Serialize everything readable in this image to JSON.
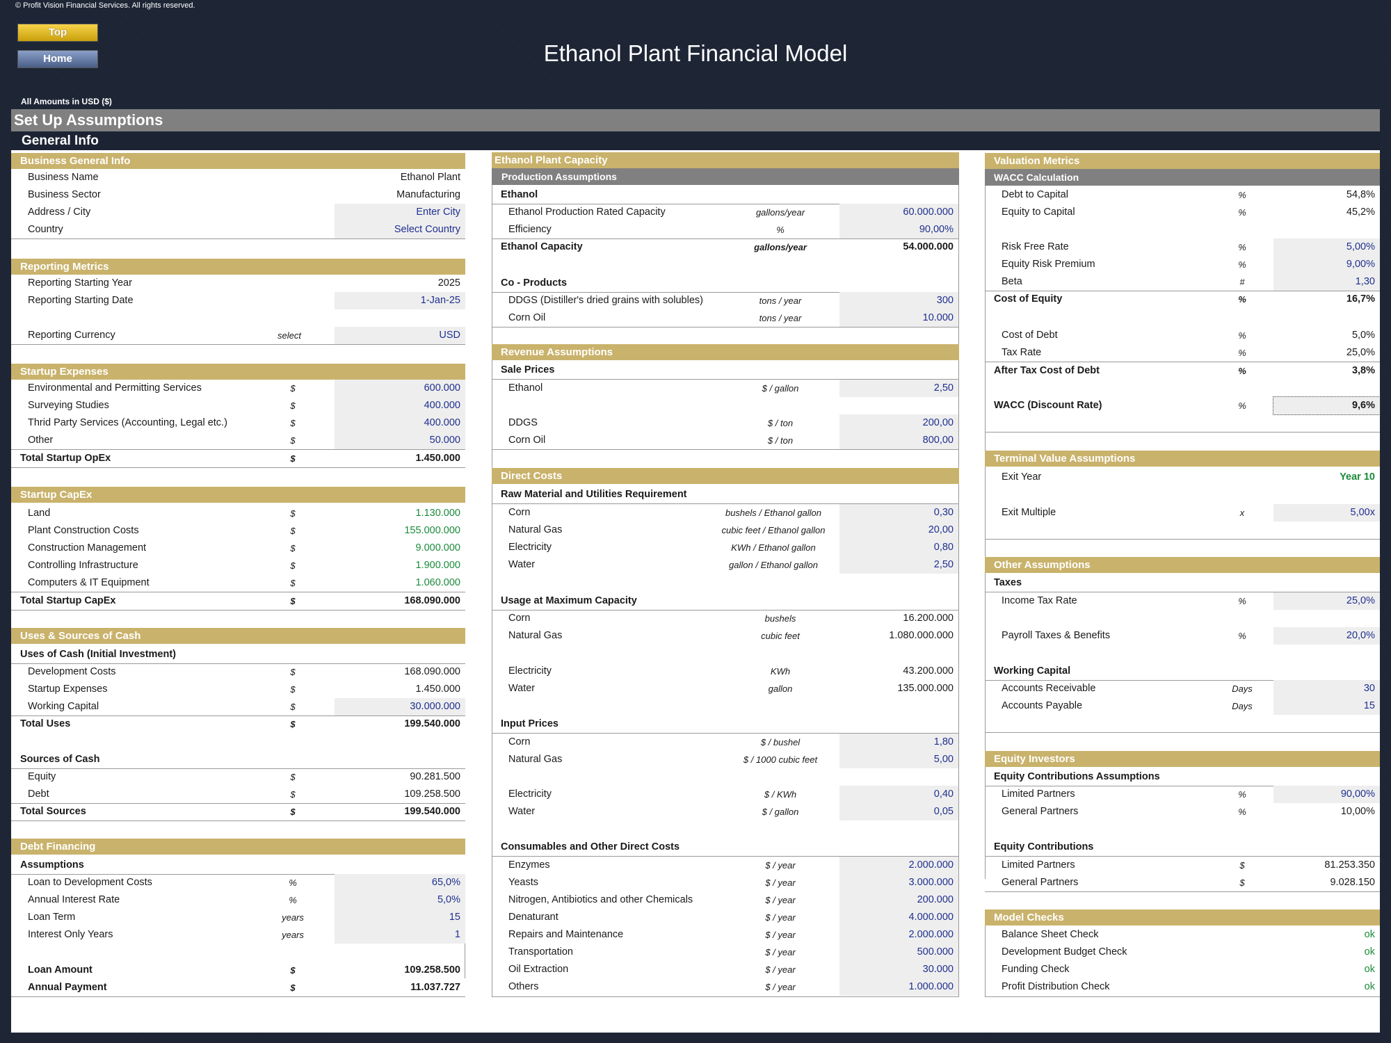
{
  "copyright": "© Profit Vision Financial Services. All rights reserved.",
  "nav": {
    "top": "Top",
    "home": "Home"
  },
  "title": "Ethanol Plant Financial Model",
  "amounts": "All Amounts in  USD ($)",
  "setup": "Set Up Assumptions",
  "general_info": "General Info",
  "col1": {
    "bgi": {
      "title": "Business General Info",
      "name_l": "Business Name",
      "name_v": "Ethanol Plant",
      "sector_l": "Business Sector",
      "sector_v": "Manufacturing",
      "addr_l": "Address / City",
      "addr_v": "Enter City",
      "country_l": "Country",
      "country_v": "Select Country"
    },
    "rep": {
      "title": "Reporting Metrics",
      "year_l": "Reporting Starting Year",
      "year_v": "2025",
      "date_l": "Reporting Starting Date",
      "date_v": "1-Jan-25",
      "cur_l": "Reporting Currency",
      "cur_u": "select",
      "cur_v": "USD"
    },
    "sx": {
      "title": "Startup Expenses",
      "r1": "Environmental and Permitting Services",
      "v1": "600.000",
      "r2": "Surveying Studies",
      "v2": "400.000",
      "r3": "Thrid Party Services (Accounting, Legal etc.)",
      "v3": "400.000",
      "r4": "Other",
      "v4": "50.000",
      "tot": "Total Startup OpEx",
      "totv": "1.450.000",
      "u": "$"
    },
    "sc": {
      "title": "Startup CapEx",
      "r1": "Land",
      "v1": "1.130.000",
      "r2": "Plant Construction Costs",
      "v2": "155.000.000",
      "r3": "Construction Management",
      "v3": "9.000.000",
      "r4": "Controlling Infrastructure",
      "v4": "1.900.000",
      "r5": "Computers & IT Equipment",
      "v5": "1.060.000",
      "tot": "Total Startup CapEx",
      "totv": "168.090.000"
    },
    "us": {
      "title": "Uses & Sources of Cash",
      "uses": "Uses of Cash (Initial Investment)",
      "r1": "Development Costs",
      "v1": "168.090.000",
      "r2": "Startup Expenses",
      "v2": "1.450.000",
      "r3": "Working Capital",
      "v3": "30.000.000",
      "tu": "Total Uses",
      "tuv": "199.540.000",
      "src": "Sources of Cash",
      "r4": "Equity",
      "v4": "90.281.500",
      "r5": "Debt",
      "v5": "109.258.500",
      "ts": "Total Sources",
      "tsv": "199.540.000"
    },
    "df": {
      "title": "Debt Financing",
      "assum": "Assumptions",
      "r1": "Loan to Development Costs",
      "u1": "%",
      "v1": "65,0%",
      "r2": "Annual Interest Rate",
      "u2": "%",
      "v2": "5,0%",
      "r3": "Loan Term",
      "u3": "years",
      "v3": "15",
      "r4": "Interest Only Years",
      "u4": "years",
      "v4": "1",
      "r5": "Loan Amount",
      "v5": "109.258.500",
      "r6": "Annual Payment",
      "v6": "11.037.727"
    }
  },
  "col2": {
    "cap": {
      "title": "Ethanol Plant Capacity",
      "prod": "Production Assumptions",
      "eth": "Ethanol",
      "r1": "Ethanol Production Rated Capacity",
      "u1": "gallons/year",
      "v1": "60.000.000",
      "r2": "Efficiency",
      "u2": "%",
      "v2": "90,00%",
      "r3": "Ethanol Capacity",
      "u3": "gallons/year",
      "v3": "54.000.000",
      "co": "Co - Products",
      "r4": "DDGS (Distiller's dried grains with solubles)",
      "u4": "tons / year",
      "v4": "300",
      "r5": "Corn Oil",
      "u5": "tons / year",
      "v5": "10.000"
    },
    "rev": {
      "title": "Revenue Assumptions",
      "sp": "Sale Prices",
      "r1": "Ethanol",
      "u1": "$ / gallon",
      "v1": "2,50",
      "r2": "DDGS",
      "u2": "$ / ton",
      "v2": "200,00",
      "r3": "Corn Oil",
      "u3": "$ / ton",
      "v3": "800,00"
    },
    "dc": {
      "title": "Direct Costs",
      "raw": "Raw Material and Utilities Requirement",
      "r1": "Corn",
      "u1": "bushels / Ethanol gallon",
      "v1": "0,30",
      "r2": "Natural Gas",
      "u2": "cubic feet / Ethanol gallon",
      "v2": "20,00",
      "r3": "Electricity",
      "u3": "KWh / Ethanol gallon",
      "v3": "0,80",
      "r4": "Water",
      "u4": "gallon / Ethanol gallon",
      "v4": "2,50",
      "usage": "Usage at Maximum Capacity",
      "r5": "Corn",
      "u5": "bushels",
      "v5": "16.200.000",
      "r6": "Natural Gas",
      "u6": "cubic feet",
      "v6": "1.080.000.000",
      "r7": "Electricity",
      "u7": "KWh",
      "v7": "43.200.000",
      "r8": "Water",
      "u8": "gallon",
      "v8": "135.000.000",
      "ip": "Input Prices",
      "r9": "Corn",
      "u9": "$ / bushel",
      "v9": "1,80",
      "r10": "Natural Gas",
      "u10": "$ / 1000 cubic feet",
      "v10": "5,00",
      "r11": "Electricity",
      "u11": "$ / KWh",
      "v11": "0,40",
      "r12": "Water",
      "u12": "$ / gallon",
      "v12": "0,05",
      "cons": "Consumables and Other Direct Costs",
      "py": "$ / year",
      "c1": "Enzymes",
      "cv1": "2.000.000",
      "c2": "Yeasts",
      "cv2": "3.000.000",
      "c3": "Nitrogen, Antibiotics and other Chemicals",
      "cv3": "200.000",
      "c4": "Denaturant",
      "cv4": "4.000.000",
      "c5": "Repairs and Maintenance",
      "cv5": "2.000.000",
      "c6": "Transportation",
      "cv6": "500.000",
      "c7": "Oil Extraction",
      "cv7": "30.000",
      "c8": "Others",
      "cv8": "1.000.000"
    }
  },
  "col3": {
    "vm": {
      "title": "Valuation Metrics",
      "wacc": "WACC Calculation",
      "r1": "Debt to Capital",
      "u1": "%",
      "v1": "54,8%",
      "r2": "Equity to Capital",
      "u2": "%",
      "v2": "45,2%",
      "r3": "Risk Free Rate",
      "u3": "%",
      "v3": "5,00%",
      "r4": "Equity Risk Premium",
      "u4": "%",
      "v4": "9,00%",
      "r5": "Beta",
      "u5": "#",
      "v5": "1,30",
      "r6": "Cost of Equity",
      "u6": "%",
      "v6": "16,7%",
      "r7": "Cost of Debt",
      "u7": "%",
      "v7": "5,0%",
      "r8": "Tax Rate",
      "u8": "%",
      "v8": "25,0%",
      "r9": "After Tax Cost of Debt",
      "u9": "%",
      "v9": "3,8%",
      "r10": "WACC (Discount Rate)",
      "u10": "%",
      "v10": "9,6%"
    },
    "tv": {
      "title": "Terminal Value Assumptions",
      "r1": "Exit Year",
      "v1": "Year 10",
      "r2": "Exit Multiple",
      "u2": "x",
      "v2": "5,00x"
    },
    "oa": {
      "title": "Other Assumptions",
      "taxes": "Taxes",
      "r1": "Income Tax Rate",
      "u1": "%",
      "v1": "25,0%",
      "r2": "Payroll Taxes & Benefits",
      "u2": "%",
      "v2": "20,0%",
      "wc": "Working Capital",
      "r3": "Accounts Receivable",
      "u3": "Days",
      "v3": "30",
      "r4": "Accounts Payable",
      "u4": "Days",
      "v4": "15"
    },
    "ei": {
      "title": "Equity Investors",
      "eca": "Equity Contributions Assumptions",
      "r1": "Limited Partners",
      "u1": "%",
      "v1": "90,00%",
      "r2": "General Partners",
      "u2": "%",
      "v2": "10,00%",
      "ec": "Equity Contributions",
      "r3": "Limited Partners",
      "u3": "$",
      "v3": "81.253.350",
      "r4": "General Partners",
      "u4": "$",
      "v4": "9.028.150"
    },
    "mc": {
      "title": "Model Checks",
      "r1": "Balance Sheet Check",
      "r2": "Development Budget Check",
      "r3": "Funding Check",
      "r4": "Profit Distribution Check",
      "ok": "ok"
    }
  }
}
